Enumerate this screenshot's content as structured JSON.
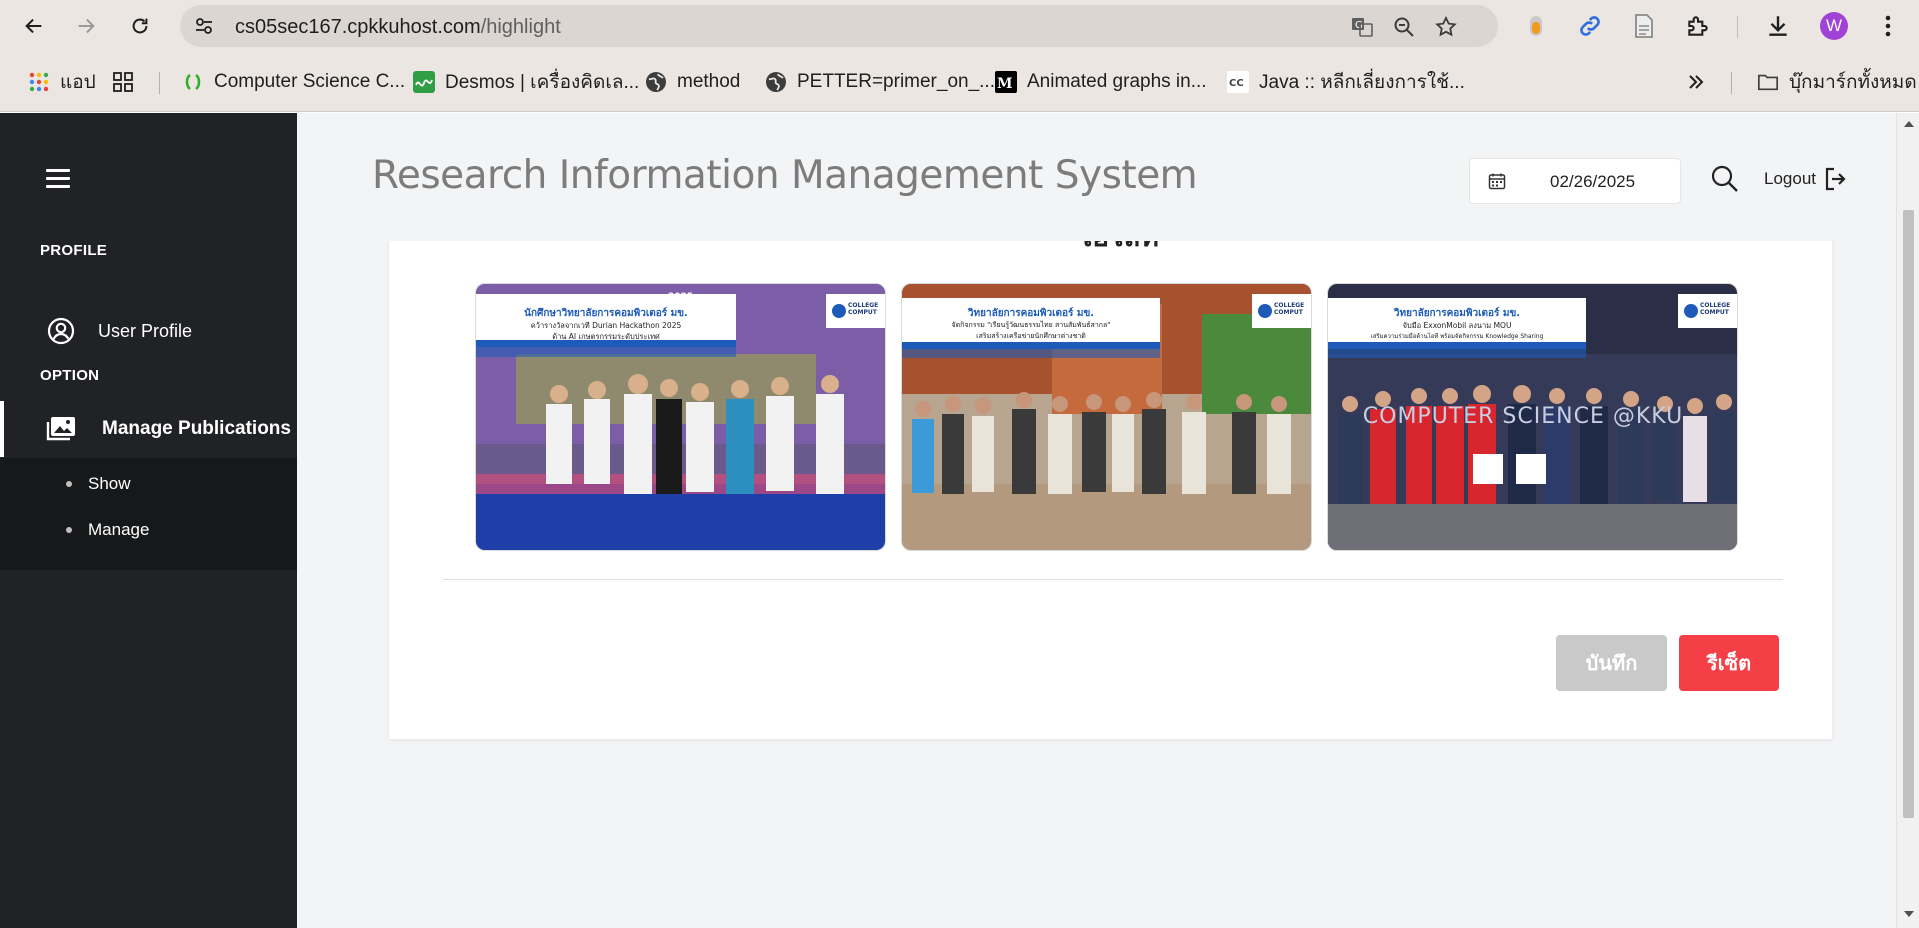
{
  "browser": {
    "url_host": "cs05sec167.cpkkuhost.com",
    "url_path": "/highlight",
    "profile_initial": "W",
    "bookmarks": [
      {
        "label": "แอป",
        "icon": "apps-grid-icon"
      },
      {
        "label": "Computer Science C...",
        "icon": "cs-logo-icon"
      },
      {
        "label": "Desmos | เครื่องคิดเล...",
        "icon": "desmos-icon"
      },
      {
        "label": "method",
        "icon": "globe-icon"
      },
      {
        "label": "PETTER=primer_on_...",
        "icon": "globe-icon"
      },
      {
        "label": "Animated graphs in...",
        "icon": "medium-icon"
      },
      {
        "label": "Java :: หลีกเลี่ยงการใช้...",
        "icon": "cc-icon"
      }
    ],
    "all_bookmarks_label": "บุ๊กมาร์กทั้งหมด"
  },
  "sidebar": {
    "profile_heading": "PROFILE",
    "user_profile_label": "User Profile",
    "option_heading": "OPTION",
    "manage_publications_label": "Manage Publications",
    "submenu": [
      {
        "label": "Show"
      },
      {
        "label": "Manage"
      }
    ]
  },
  "header": {
    "title": "Research Information Management System",
    "date": "02/26/2025",
    "logout_label": "Logout"
  },
  "content": {
    "cut_title": "ไฮไลท์",
    "photos": [
      {
        "headline": "นักศึกษาวิทยาลัยการคอมพิวเตอร์ มข.",
        "line2": "คว้ารางวัลจากเวที Durian Hackathon 2025",
        "line3": "ด้าน AI เกษตรกรรมระดับประเทศ",
        "year": "2025",
        "logo_text": "COLLEGE COMPUT"
      },
      {
        "headline": "วิทยาลัยการคอมพิวเตอร์ มข.",
        "line2": "จัดกิจกรรม \"เรียนรู้วัฒนธรรมไทย สานสัมพันธ์สากล\"",
        "line3": "เสริมสร้างเครือข่ายนักศึกษาต่างชาติ",
        "logo_text": "COLLEGE COMPUT"
      },
      {
        "headline": "วิทยาลัยการคอมพิวเตอร์ มข.",
        "line2": "จับมือ ExxonMobil ลงนาม MOU",
        "line3": "เสริมความร่วมมือด้านไอที พร้อมจัดกิจกรรม Knowledge Sharing",
        "wall_text": "COMPUTER SCIENCE @KKU",
        "logo_text": "COLLEGE COMPUT"
      }
    ],
    "save_label": "บันทึก",
    "reset_label": "รีเซ็ต"
  },
  "colors": {
    "sidebar_bg": "#212225",
    "reset_button": "#f43f46",
    "save_button_disabled": "#c9c9c9",
    "profile_avatar": "#a142d6"
  }
}
